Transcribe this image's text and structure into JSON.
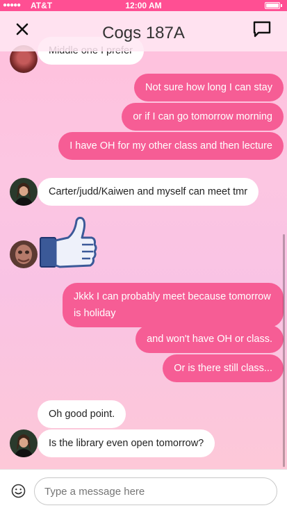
{
  "status_bar": {
    "signal": "●●●●●",
    "carrier": "AT&T",
    "time": "12:00 AM"
  },
  "header": {
    "title": "Cogs 187A"
  },
  "messages": [
    {
      "direction": "in",
      "text": "Middle one I prefer"
    },
    {
      "direction": "out",
      "text": "Not sure how long I can stay"
    },
    {
      "direction": "out",
      "text": "or if I can go tomorrow morning"
    },
    {
      "direction": "out",
      "text": "I have OH for my other class and then lecture"
    },
    {
      "direction": "in",
      "text": "Carter/judd/Kaiwen and myself can meet tmr"
    },
    {
      "direction": "in",
      "type": "sticker",
      "sticker": "thumbs-up"
    },
    {
      "direction": "out",
      "text": "Jkkk I can probably meet because tomorrow is holiday"
    },
    {
      "direction": "out",
      "text": "and won't have OH or class."
    },
    {
      "direction": "out",
      "text": "Or is there still class..."
    },
    {
      "direction": "in",
      "text": "Oh good point."
    },
    {
      "direction": "in",
      "text": "Is the library even open tomorrow?"
    }
  ],
  "composer": {
    "placeholder": "Type a message here"
  },
  "colors": {
    "status_bar": "#ff4f93",
    "outgoing_bubble": "#f65d95",
    "incoming_bubble": "#ffffff"
  }
}
